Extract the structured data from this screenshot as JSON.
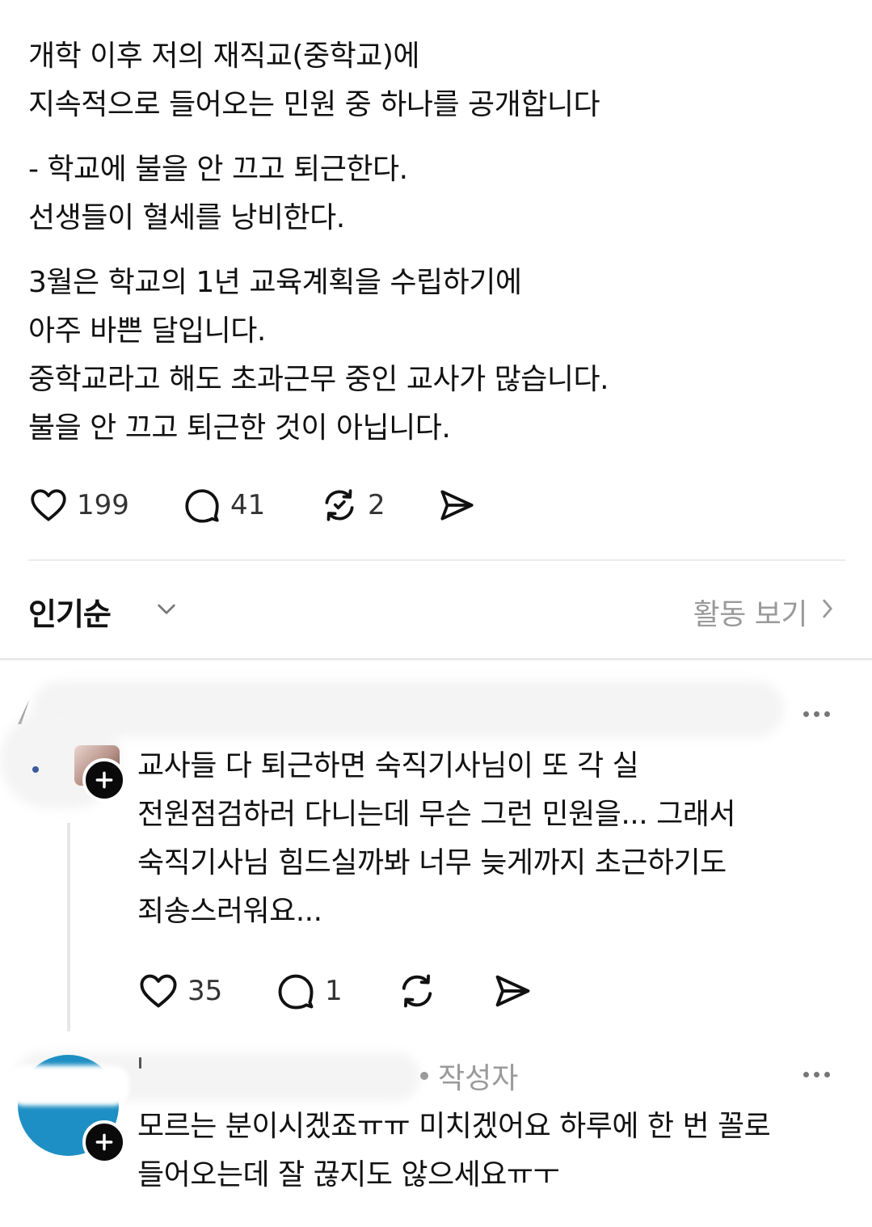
{
  "post": {
    "paragraphs": [
      [
        "개학 이후 저의 재직교(중학교)에",
        "지속적으로 들어오는 민원 중 하나를 공개합니다"
      ],
      [
        "- 학교에 불을 안 끄고 퇴근한다.",
        "선생들이 혈세를 낭비한다."
      ],
      [
        "3월은 학교의 1년 교육계획을 수립하기에",
        "아주 바쁜 달입니다.",
        "중학교라고 해도 초과근무 중인 교사가 많습니다.",
        "불을 안 끄고 퇴근한 것이 아닙니다."
      ]
    ],
    "likes": "199",
    "replies": "41",
    "reposts": "2"
  },
  "sort": {
    "label": "인기순",
    "activity_link": "활동 보기"
  },
  "comments": [
    {
      "lines": [
        "교사들 다 퇴근하면 숙직기사님이 또 각 실",
        "전원점검하러 다니는데 무슨 그런 민원을... 그래서",
        "숙직기사님 힘드실까봐 너무 늦게까지 초근하기도",
        "죄송스러워요..."
      ],
      "likes": "35",
      "replies": "1"
    },
    {
      "author_tag": "작성자",
      "lines": [
        "모르는 분이시겠죠ㅠㅠ 미치겠어요 하루에 한 번 꼴로",
        "들어오는데 잘 끊지도 않으세요ㅠㅜ"
      ]
    }
  ],
  "colors": {
    "text": "#111111",
    "muted": "#9a9a9a",
    "avatar_blue": "#1d8fc4"
  },
  "icons": [
    "heart-icon",
    "comment-icon",
    "repost-icon",
    "share-icon",
    "chevron-down-icon",
    "chevron-right-icon",
    "plus-icon",
    "more-icon"
  ]
}
